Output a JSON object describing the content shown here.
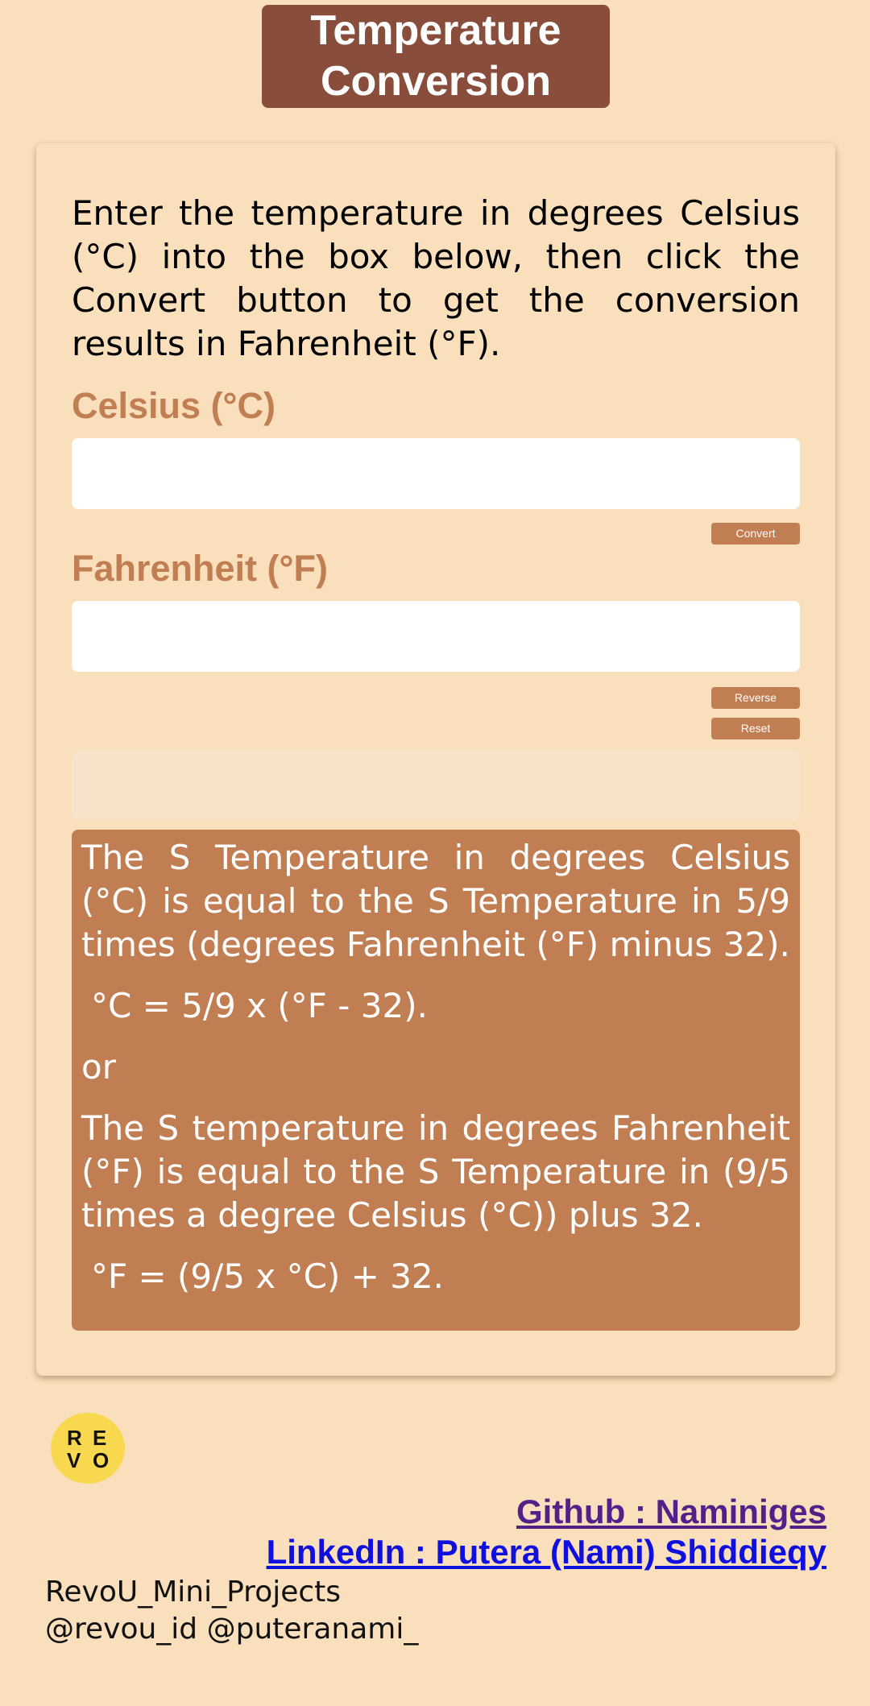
{
  "header": {
    "title": "Temperature Conversion"
  },
  "converter": {
    "intro": "Enter the temperature in degrees Celsius (°C) into the box below, then click the Convert button to get the conversion results in Fahrenheit (°F).",
    "celsius_label": "Celsius (°C)",
    "celsius_value": "",
    "convert_label": "Convert",
    "fahrenheit_label": "Fahrenheit (°F)",
    "fahrenheit_value": "",
    "reverse_label": "Reverse",
    "reset_label": "Reset",
    "result_text": ""
  },
  "explanation": {
    "para1": "The S Temperature in degrees Celsius (°C) is equal to the S Temperature in 5/9 times (degrees Fahrenheit (°F) minus 32).",
    "formula1": "°C = 5/9 x (°F - 32).",
    "or": "or",
    "para2": "The S temperature in degrees Fahrenheit (°F) is equal to the S Temperature in (9/5 times a degree Celsius (°C)) plus 32.",
    "formula2": "°F = (9/5 x °C) + 32."
  },
  "footer": {
    "logo_letters": [
      "R",
      "E",
      "V",
      "O"
    ],
    "github_link": "Github : Naminiges",
    "linkedin_link": "LinkedIn : Putera (Nami) Shiddieqy",
    "project_name": "RevoU_Mini_Projects",
    "handles": "@revou_id @puteranami_"
  },
  "colors": {
    "background": "#f9dfbb",
    "title_bg": "#884d3b",
    "accent": "#c27e53",
    "github": "#531f89",
    "linkedin": "#0f0fe0",
    "logo": "#f8d84e"
  }
}
